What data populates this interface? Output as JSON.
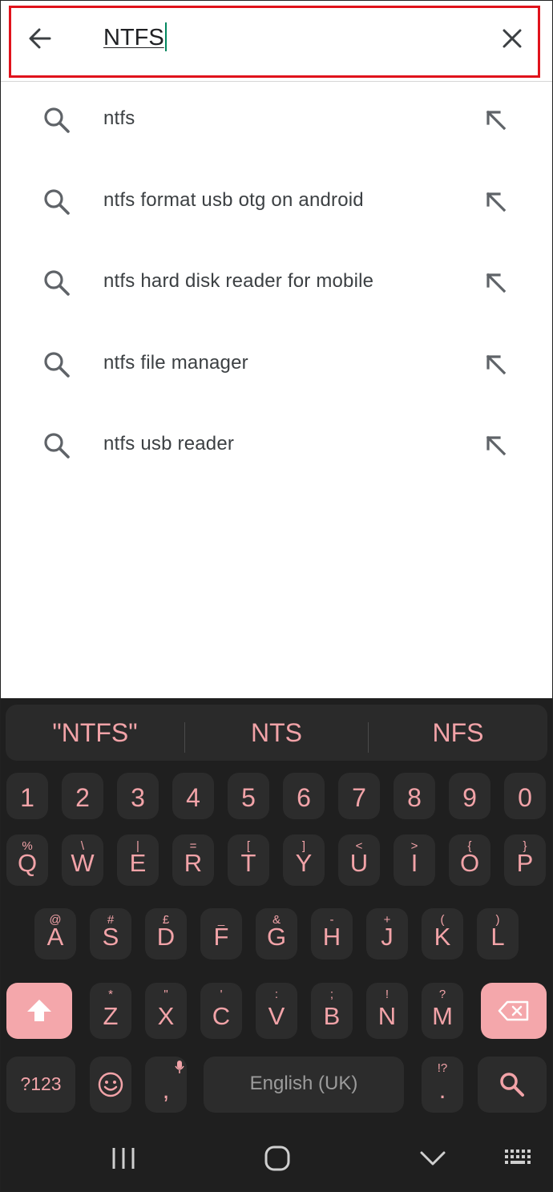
{
  "search": {
    "query": "NTFS",
    "back_icon": "arrow-left-icon",
    "clear_icon": "close-icon"
  },
  "suggestions": [
    {
      "text": "ntfs"
    },
    {
      "text": "ntfs format usb otg on android"
    },
    {
      "text": "ntfs hard disk reader for mobile"
    },
    {
      "text": "ntfs file manager"
    },
    {
      "text": "ntfs usb reader"
    }
  ],
  "keyboard": {
    "predictions": [
      "\"NTFS\"",
      "NTS",
      "NFS"
    ],
    "number_row": [
      "1",
      "2",
      "3",
      "4",
      "5",
      "6",
      "7",
      "8",
      "9",
      "0"
    ],
    "row1": [
      {
        "main": "Q",
        "sub": "%"
      },
      {
        "main": "W",
        "sub": "\\"
      },
      {
        "main": "E",
        "sub": "|"
      },
      {
        "main": "R",
        "sub": "="
      },
      {
        "main": "T",
        "sub": "["
      },
      {
        "main": "Y",
        "sub": "]"
      },
      {
        "main": "U",
        "sub": "<"
      },
      {
        "main": "I",
        "sub": ">"
      },
      {
        "main": "O",
        "sub": "{"
      },
      {
        "main": "P",
        "sub": "}"
      }
    ],
    "row2": [
      {
        "main": "A",
        "sub": "@"
      },
      {
        "main": "S",
        "sub": "#"
      },
      {
        "main": "D",
        "sub": "£"
      },
      {
        "main": "F",
        "sub": "_"
      },
      {
        "main": "G",
        "sub": "&"
      },
      {
        "main": "H",
        "sub": "-"
      },
      {
        "main": "J",
        "sub": "+"
      },
      {
        "main": "K",
        "sub": "("
      },
      {
        "main": "L",
        "sub": ")"
      }
    ],
    "row3": [
      {
        "main": "Z",
        "sub": "*"
      },
      {
        "main": "X",
        "sub": "\""
      },
      {
        "main": "C",
        "sub": "'"
      },
      {
        "main": "V",
        "sub": ":"
      },
      {
        "main": "B",
        "sub": ";"
      },
      {
        "main": "N",
        "sub": "!"
      },
      {
        "main": "M",
        "sub": "?"
      }
    ],
    "sym_label": "?123",
    "comma": ",",
    "space_label": "English (UK)",
    "period": ".",
    "period_sub": "!?",
    "colors": {
      "background": "#1f1f1f",
      "key": "#2c2c2c",
      "text": "#f2a3a8",
      "accent": "#f4a7ab"
    }
  },
  "navbar": {
    "recent_icon": "recent-apps-icon",
    "home_icon": "home-icon",
    "back_icon": "chevron-down-icon",
    "keyboard_icon": "keyboard-icon"
  }
}
